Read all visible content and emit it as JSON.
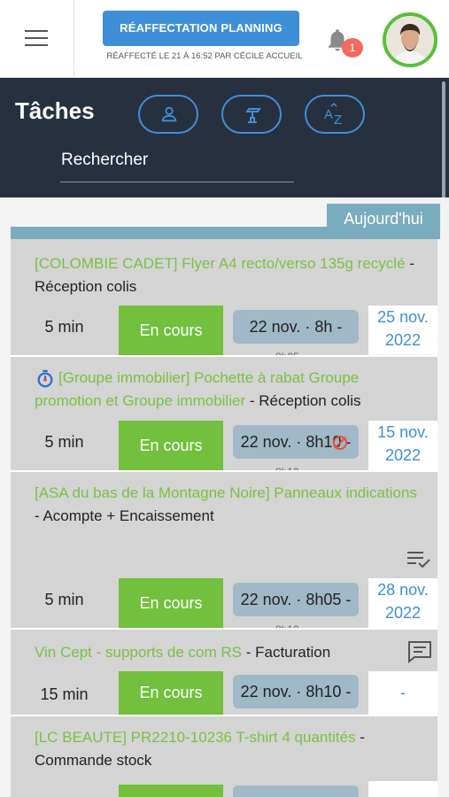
{
  "header": {
    "reassign_label": "RÉAFFECTATION PLANNING",
    "reassign_sub": "RÉAFFECTÉ LE 21 À 16:52 PAR CÉCILE ACCUEIL",
    "notif_count": "1"
  },
  "tasks_header": {
    "title": "Tâches",
    "search_placeholder": "Rechercher",
    "filters": [
      "user-icon",
      "drill-icon",
      "sort-az-icon"
    ]
  },
  "today_label": "Aujourd'hui",
  "tasks": [
    {
      "client": "[COLOMBIE CADET] Flyer A4 recto/verso 135g recyclé",
      "step": " - Réception colis",
      "duration": "5 min",
      "status": "En cours",
      "start": "22 nov. · 8h -",
      "start_ghost": "8h05",
      "due": "25 nov. 2022"
    },
    {
      "client": "[Groupe immobilier] Pochette à rabat Groupe promotion et Groupe immobilier",
      "step": " - Réception colis",
      "duration": "5 min",
      "status": "En cours",
      "start": "22 nov. · 8h10 -",
      "start_ghost": "8h10",
      "due": "15 nov. 2022"
    },
    {
      "client": "[ASA du bas de la Montagne Noire] Panneaux indications",
      "step": " - Acompte + Encaissement",
      "duration": "5 min",
      "status": "En cours",
      "start": "22 nov. · 8h05 -",
      "start_ghost": "8h10",
      "due": "28 nov. 2022"
    },
    {
      "client": "Vin Cept - supports de com RS",
      "step": " - Facturation",
      "duration": "15 min",
      "status": "En cours",
      "start": "22 nov. · 8h10 -",
      "due": "-"
    },
    {
      "client": "[LC BEAUTE] PR2210-10236 T-shirt 4 quantités",
      "step": " - Commande stock"
    }
  ]
}
